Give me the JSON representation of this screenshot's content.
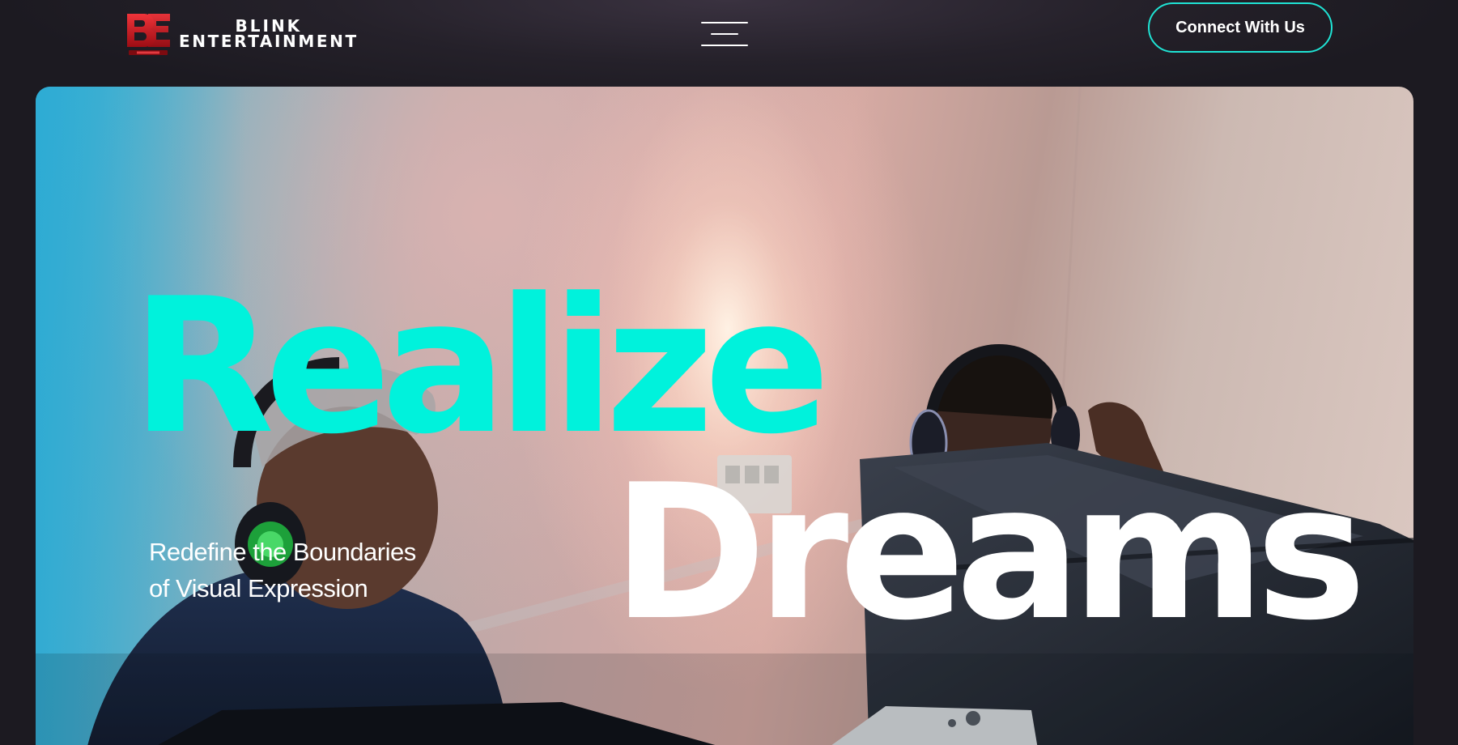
{
  "header": {
    "logo": {
      "line1": "BLINK",
      "line2": "ENTERTAINMENT",
      "brand_color": "#d0161f"
    },
    "menu_icon": "hamburger-menu-icon",
    "cta_label": "Connect With Us",
    "cta_border_color": "#1fe3d4"
  },
  "hero": {
    "title_line1": "Realize",
    "title_line1_color": "#00f2dc",
    "title_line2": "Dreams",
    "title_line2_color": "#ffffff",
    "subtitle_line1": "Redefine the Boundaries",
    "subtitle_line2": "of Visual Expression",
    "background": "photo of two people wearing headphones working at computers"
  }
}
